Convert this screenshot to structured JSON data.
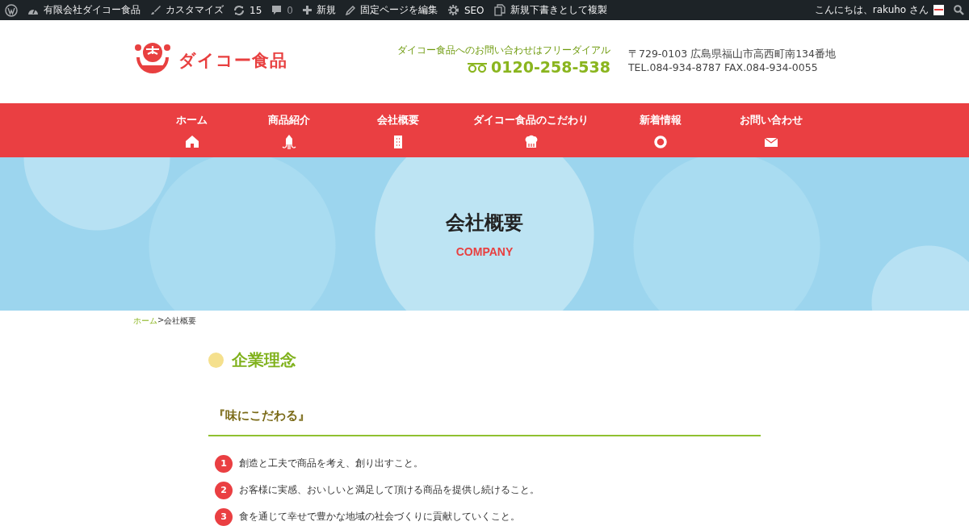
{
  "admin_bar": {
    "items": [
      {
        "kind": "wp"
      },
      {
        "kind": "site",
        "label": "有限会社ダイコー食品"
      },
      {
        "kind": "customize",
        "label": "カスタマイズ"
      },
      {
        "kind": "updates",
        "label": "15"
      },
      {
        "kind": "comments",
        "label": "0"
      },
      {
        "kind": "new",
        "label": "新規"
      },
      {
        "kind": "edit",
        "label": "固定ページを編集"
      },
      {
        "kind": "seo",
        "label": "SEO"
      },
      {
        "kind": "duplicate",
        "label": "新規下書きとして複製"
      }
    ],
    "greeting": "こんにちは、rakuho さん"
  },
  "header": {
    "logo_text": "ダイコー食品",
    "free_dial_label": "ダイコー食品へのお問い合わせはフリーダイアル",
    "phone": "0120-258-538",
    "address": "〒729-0103 広島県福山市高西町南134番地",
    "tel_fax": "TEL.084-934-8787 FAX.084-934-0055"
  },
  "nav": [
    {
      "label": "ホーム",
      "kind": "home"
    },
    {
      "label": "商品紹介",
      "kind": "products"
    },
    {
      "label": "会社概要",
      "kind": "company"
    },
    {
      "label": "ダイコー食品のこだわり",
      "kind": "commitment"
    },
    {
      "label": "新着情報",
      "kind": "news"
    },
    {
      "label": "お問い合わせ",
      "kind": "contact"
    }
  ],
  "hero": {
    "title": "会社概要",
    "subtitle": "COMPANY"
  },
  "breadcrumb": {
    "home": "ホーム",
    "separator": ">",
    "current": "会社概要"
  },
  "section": {
    "heading": "企業理念",
    "subheading": "『味にこだわる』",
    "items": [
      {
        "number": "1",
        "text": "創造と工夫で商品を考え、創り出すこと。"
      },
      {
        "number": "2",
        "text": "お客様に実感、おいしいと満足して頂ける商品を提供し続けること。"
      },
      {
        "number": "3",
        "text": "食を通じて幸せで豊かな地域の社会づくりに貢献していくこと。"
      }
    ]
  }
}
